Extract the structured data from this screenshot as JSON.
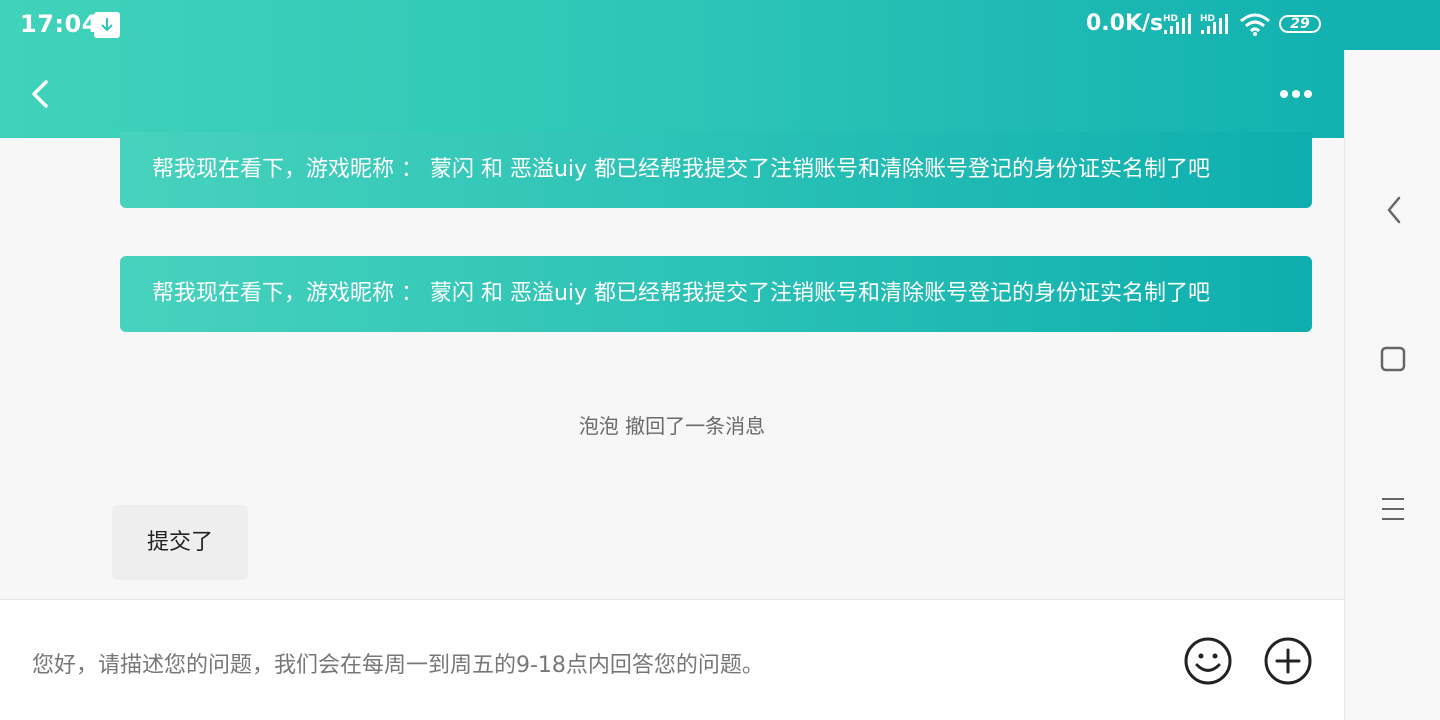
{
  "status_bar": {
    "time": "17:04",
    "net_speed": "0.0K/s",
    "sim1_label": "HD",
    "sim2_label": "HD",
    "battery": "29"
  },
  "header": {
    "back_icon": "chevron-left-icon",
    "more_icon": "more-dots-icon"
  },
  "messages": [
    {
      "text": "帮我现在看下，游戏昵称 ： 蒙闪 和 恶溢uiy 都已经帮我提交了注销账号和清除账号登记的身份证实名制了吧",
      "side": "right"
    },
    {
      "text": "帮我现在看下，游戏昵称 ： 蒙闪 和 恶溢uiy 都已经帮我提交了注销账号和清除账号登记的身份证实名制了吧",
      "side": "right"
    }
  ],
  "system_notice": "泡泡 撤回了一条消息",
  "reply": {
    "text": "提交了",
    "side": "left"
  },
  "input": {
    "placeholder": "您好，请描述您的问题，我们会在每周一到周五的9-18点内回答您的问题。"
  },
  "colors": {
    "header_start": "#40d3bb",
    "header_end": "#12b1b0",
    "bubble_start": "#47d2bd",
    "bubble_end": "#0eaeae"
  }
}
